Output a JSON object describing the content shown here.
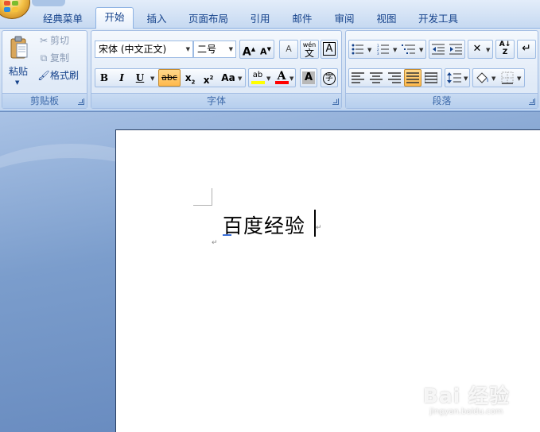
{
  "tabs": [
    {
      "label": "经典菜单",
      "active": false
    },
    {
      "label": "开始",
      "active": true
    },
    {
      "label": "插入",
      "active": false
    },
    {
      "label": "页面布局",
      "active": false
    },
    {
      "label": "引用",
      "active": false
    },
    {
      "label": "邮件",
      "active": false
    },
    {
      "label": "审阅",
      "active": false
    },
    {
      "label": "视图",
      "active": false
    },
    {
      "label": "开发工具",
      "active": false
    }
  ],
  "clipboard": {
    "group_label": "剪贴板",
    "paste_label": "粘贴",
    "cut_label": "剪切",
    "copy_label": "复制",
    "format_painter_label": "格式刷"
  },
  "font": {
    "group_label": "字体",
    "font_name": "宋体 (中文正文)",
    "font_size": "二号",
    "grow_glyph": "A",
    "shrink_glyph": "A",
    "clear_format_glyph": "A",
    "phonetic_glyph": "wén",
    "char_border_glyph": "A",
    "bold_glyph": "B",
    "italic_glyph": "I",
    "underline_glyph": "U",
    "strike_glyph": "abc",
    "subscript_glyph": "x",
    "subscript_mark": "2",
    "superscript_glyph": "x",
    "superscript_mark": "2",
    "case_glyph": "Aa",
    "highlight_glyph": "ab",
    "font_color_glyph": "A",
    "char_shading_glyph": "A",
    "enclose_glyph": "字",
    "highlight_color": "#ffff00",
    "font_color": "#ff0000"
  },
  "paragraph": {
    "group_label": "段落",
    "sort_glyph": "A",
    "sort_glyph2": "Z"
  },
  "document": {
    "text": "百度经验",
    "para_mark": "↵"
  },
  "watermark": {
    "brand": "Bai 经验",
    "url": "jingyan.baidu.com"
  },
  "colors": {
    "accent": "#15428b",
    "ribbon_bg": "#dfe9f6",
    "workspace_bg": "#6e8fc0"
  }
}
